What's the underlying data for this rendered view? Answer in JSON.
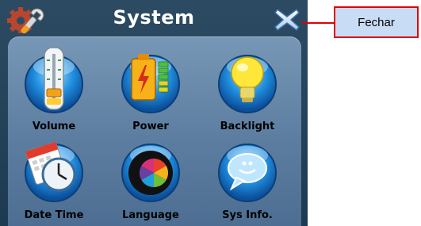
{
  "header": {
    "title": "System",
    "settings_icon": "wrench-gear-icon",
    "close_icon": "close-x-icon"
  },
  "menu": {
    "items": [
      {
        "label": "Volume",
        "icon": "volume-slider-icon"
      },
      {
        "label": "Power",
        "icon": "battery-icon"
      },
      {
        "label": "Backlight",
        "icon": "light-bulb-icon"
      },
      {
        "label": "Date Time",
        "icon": "calendar-clock-icon"
      },
      {
        "label": "Language",
        "icon": "color-wheel-icon"
      },
      {
        "label": "Sys Info.",
        "icon": "speech-bubble-icon"
      }
    ]
  },
  "callout": {
    "label": "Fechar"
  },
  "colors": {
    "header_bg": "#2c4b62",
    "panel_bg": "#6a8bad",
    "orb_blue": "#1f8fe0",
    "callout_border": "#e10000",
    "callout_bg": "#c8dcf5"
  }
}
